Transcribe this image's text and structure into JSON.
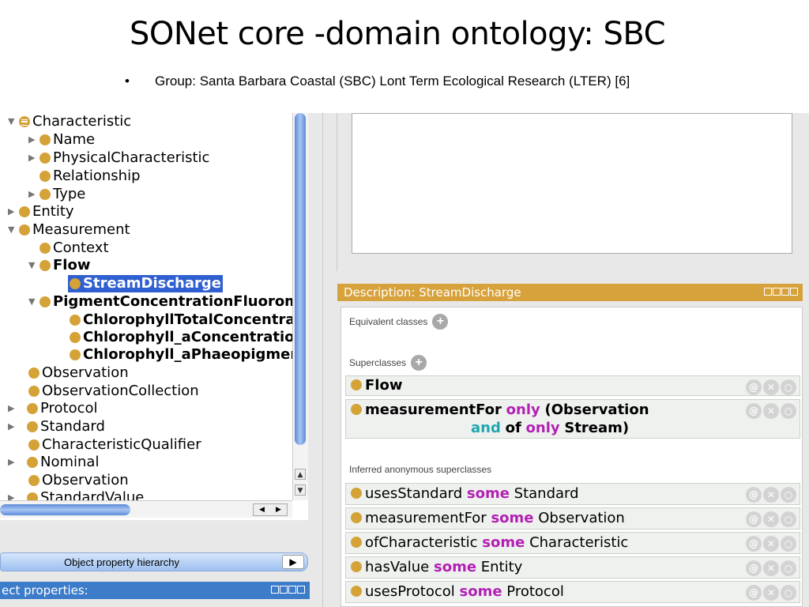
{
  "slide": {
    "title": "SONet core -domain ontology: SBC",
    "bullet_marker": "•",
    "bullet": "Group: Santa Barbara Coastal (SBC) Lont Term Ecological Research (LTER) [6]"
  },
  "tree": {
    "items": [
      {
        "label": "Characteristic",
        "expanded": true
      },
      {
        "label": "Name"
      },
      {
        "label": "PhysicalCharacteristic"
      },
      {
        "label": "Relationship"
      },
      {
        "label": "Type"
      },
      {
        "label": "Entity"
      },
      {
        "label": "Measurement",
        "expanded": true
      },
      {
        "label": "Context"
      },
      {
        "label": "Flow",
        "expanded": true
      },
      {
        "label": "StreamDischarge",
        "selected": true
      },
      {
        "label": "PigmentConcentrationFluorom",
        "expanded": true
      },
      {
        "label": "ChlorophyllTotalConcentrati"
      },
      {
        "label": "Chlorophyll_aConcentrationI"
      },
      {
        "label": "Chlorophyll_aPhaeopigment"
      },
      {
        "label": "Observation"
      },
      {
        "label": "ObservationCollection"
      },
      {
        "label": "Protocol"
      },
      {
        "label": "Standard"
      },
      {
        "label": "CharacteristicQualifier"
      },
      {
        "label": "Nominal"
      },
      {
        "label": "Observation"
      },
      {
        "label": "StandardValue"
      }
    ]
  },
  "object_property_hierarchy": {
    "label": "Object property hierarchy",
    "button": "▶"
  },
  "object_properties_bar": {
    "label": "ect properties:"
  },
  "description": {
    "header": "Description: StreamDischarge",
    "equivalent_label": "Equivalent classes",
    "superclasses_label": "Superclasses",
    "inferred_label": "Inferred anonymous superclasses",
    "superclasses": {
      "flow": "Flow",
      "mf_prop": "measurementFor",
      "mf_only": "only",
      "mf_obs": "(Observation",
      "mf_and": "and",
      "mf_of": "of",
      "mf_only2": "only",
      "mf_stream": "Stream)"
    },
    "inferred": [
      {
        "prop": "usesStandard",
        "kw": "some",
        "cls": "Standard"
      },
      {
        "prop": "measurementFor",
        "kw": "some",
        "cls": "Observation"
      },
      {
        "prop": "ofCharacteristic",
        "kw": "some",
        "cls": "Characteristic"
      },
      {
        "prop": "hasValue",
        "kw": "some",
        "cls": "Entity"
      },
      {
        "prop": "usesProtocol",
        "kw": "some",
        "cls": "Protocol"
      }
    ]
  },
  "icons": {
    "at": "@",
    "x": "✕",
    "o": "○",
    "plus": "+",
    "arrow_expanded": "▼",
    "arrow_collapsed": "▶"
  },
  "colors": {
    "class_bullet": "#d4a237",
    "desc_header": "#d7a23c",
    "selection": "#2f5fd0",
    "keyword_some": "#b221b4",
    "keyword_and": "#22a7b0"
  }
}
